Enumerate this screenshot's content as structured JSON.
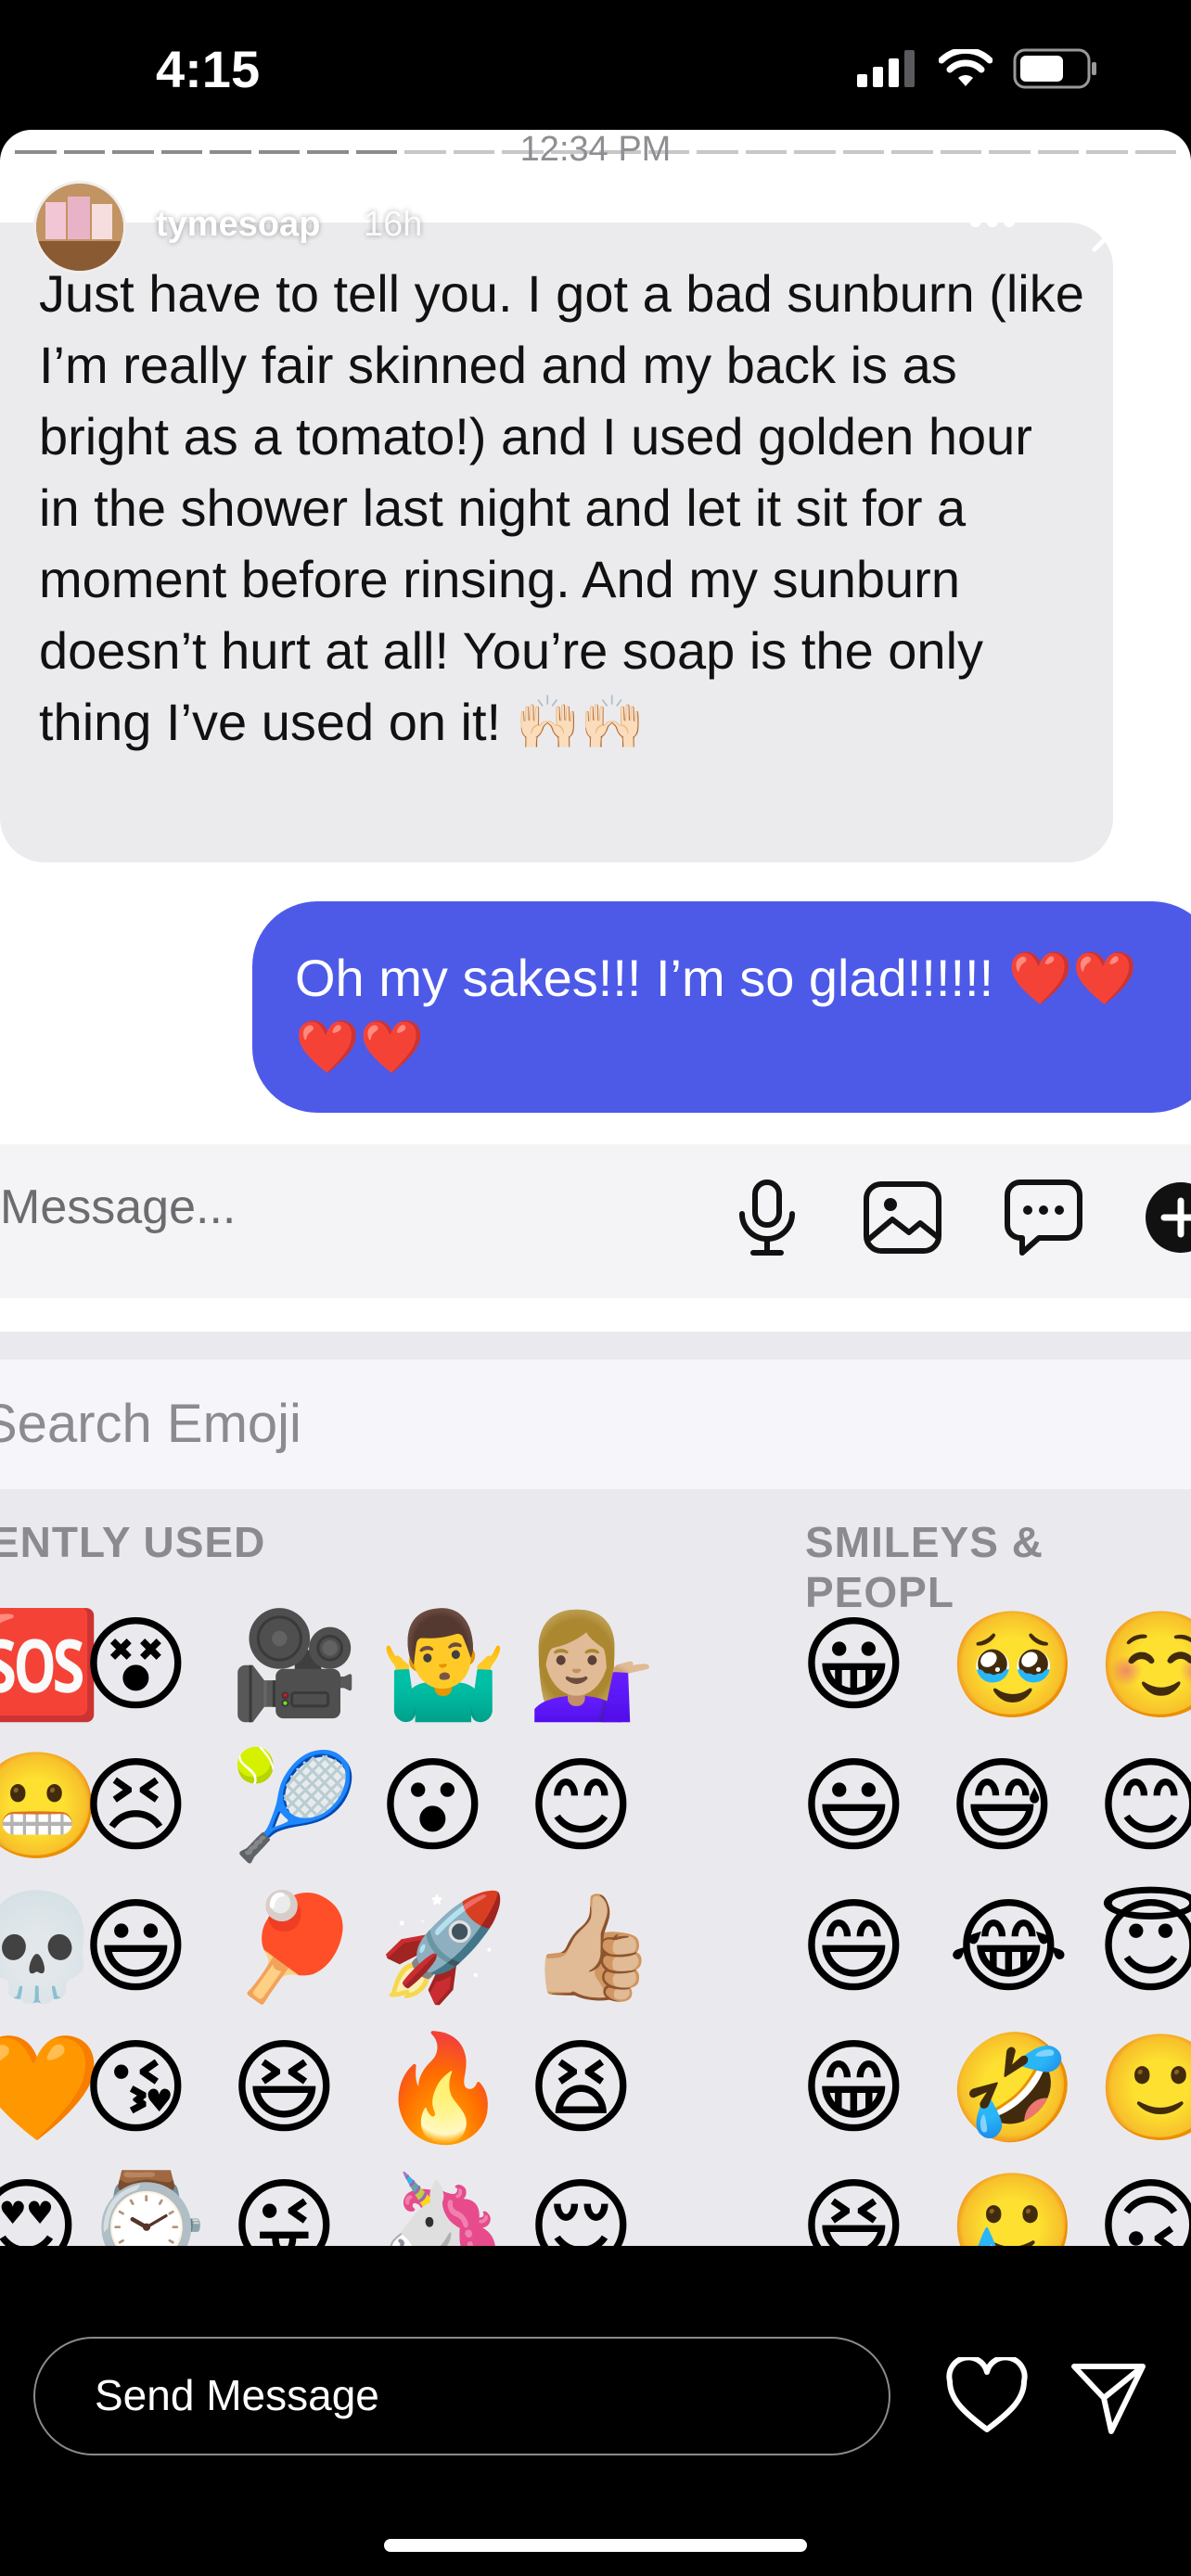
{
  "status_bar": {
    "time": "4:15"
  },
  "story": {
    "timestamp": "12:34 PM",
    "username": "tymesoap",
    "time_ago": "16h",
    "more_label": "•••"
  },
  "messages": [
    {
      "text": "Just have to tell you. I got a bad sunburn (like I’m really fair skinned and my back is as bright as a tomato!) and I used golden hour in the shower last night and let it sit for a moment before rinsing. And my sunburn doesn’t hurt at all! You’re soap is the only thing I’ve used on it! 🙌🏻🙌🏻"
    },
    {
      "line1": "Oh my sakes!!! I’m so glad!!!!!! ❤️❤️",
      "line2": "❤️❤️"
    }
  ],
  "composer": {
    "placeholder": "Message..."
  },
  "emoji_keyboard": {
    "search_placeholder": "Search Emoji",
    "recent_label": "ENTLY USED",
    "smileys_label": "SMILEYS & PEOPL",
    "recent_rows": [
      [
        "🆘",
        "😵",
        "🎥",
        "🤷‍♂️",
        "💁🏼‍♀️"
      ],
      [
        "😬",
        "😣",
        "🎾",
        "😮",
        "😊"
      ],
      [
        "💀",
        "😃",
        "🏓",
        "🚀",
        "👍🏼"
      ],
      [
        "🧡",
        "😘",
        "😆",
        "🔥",
        "😫"
      ],
      [
        "😍",
        "⌚",
        "😜",
        "🦄",
        "😌"
      ]
    ],
    "smiley_rows": [
      [
        "😀",
        "🥹",
        "☺️"
      ],
      [
        "😃",
        "😅",
        "😊"
      ],
      [
        "😄",
        "😂",
        "😇"
      ],
      [
        "😁",
        "🤣",
        "🙂"
      ],
      [
        "😆",
        "🥲",
        "🙃"
      ]
    ]
  },
  "bottom_bar": {
    "placeholder": "Send Message"
  }
}
